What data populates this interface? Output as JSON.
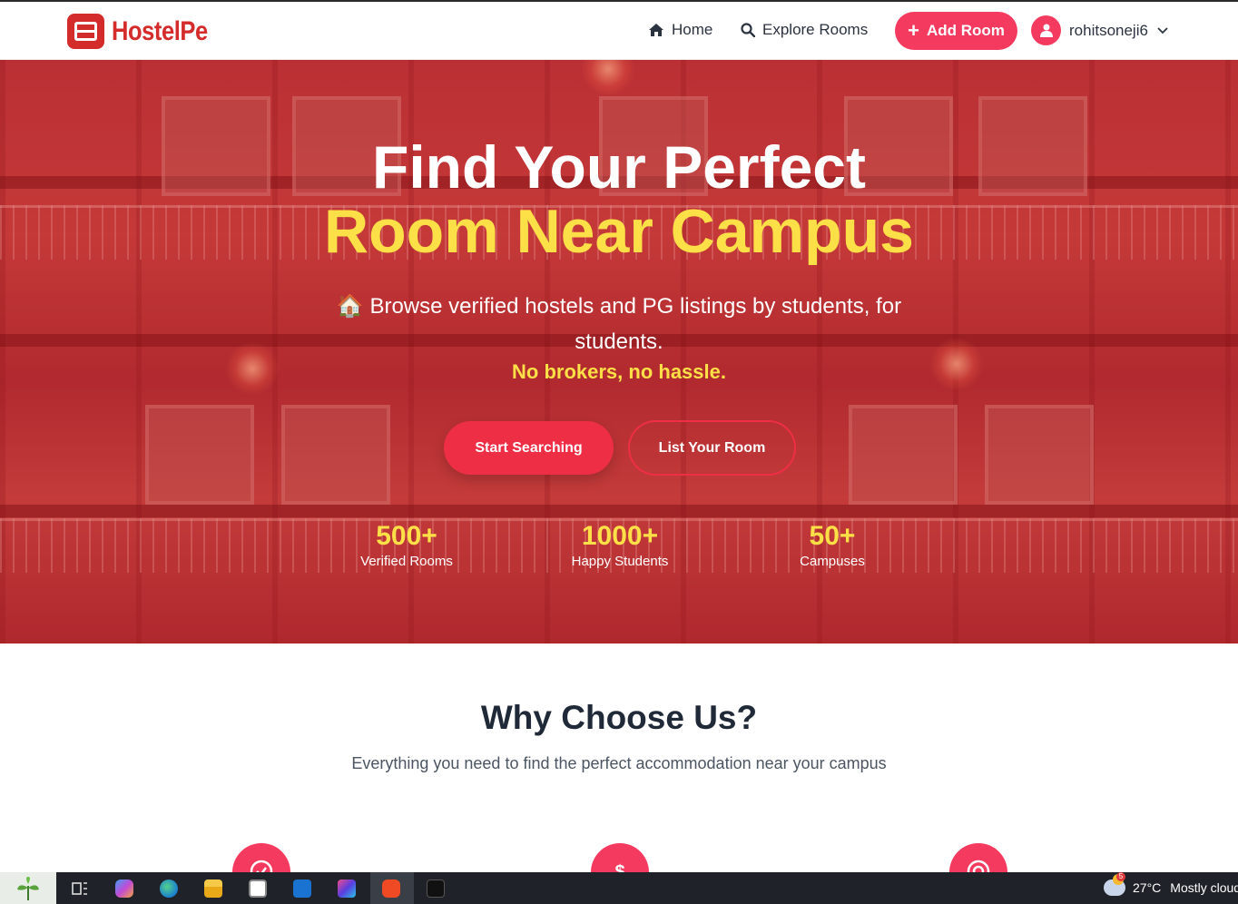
{
  "brand": {
    "name": "HostelPe",
    "color": "#d42b2b"
  },
  "nav": {
    "home": "Home",
    "explore": "Explore Rooms",
    "add_room": "Add Room",
    "username": "rohitsoneji6",
    "accent": "#f53a5f"
  },
  "hero": {
    "title_line1": "Find Your Perfect",
    "title_line2": "Room Near Campus",
    "subtitle": "🏠 Browse verified hostels and PG listings by students, for students.",
    "tagline": "No brokers, no hassle.",
    "primary_button": "Start Searching",
    "secondary_button": "List Your Room",
    "highlight_color": "#fde047",
    "stats": [
      {
        "number": "500+",
        "label": "Verified Rooms"
      },
      {
        "number": "1000+",
        "label": "Happy Students"
      },
      {
        "number": "50+",
        "label": "Campuses"
      }
    ]
  },
  "why": {
    "title": "Why Choose Us?",
    "subtitle": "Everything you need to find the perfect accommodation near your campus",
    "features": [
      {
        "icon": "check-circle-icon"
      },
      {
        "icon": "dollar-icon"
      },
      {
        "icon": "target-icon"
      }
    ]
  },
  "taskbar": {
    "weather_temp": "27°C",
    "weather_desc": "Mostly cloud",
    "weather_badge": "5",
    "apps": [
      "task-view-icon",
      "copilot-icon",
      "edge-icon",
      "file-explorer-icon",
      "store-icon",
      "outlook-icon",
      "intellij-icon",
      "brave-icon",
      "terminal-icon"
    ]
  }
}
